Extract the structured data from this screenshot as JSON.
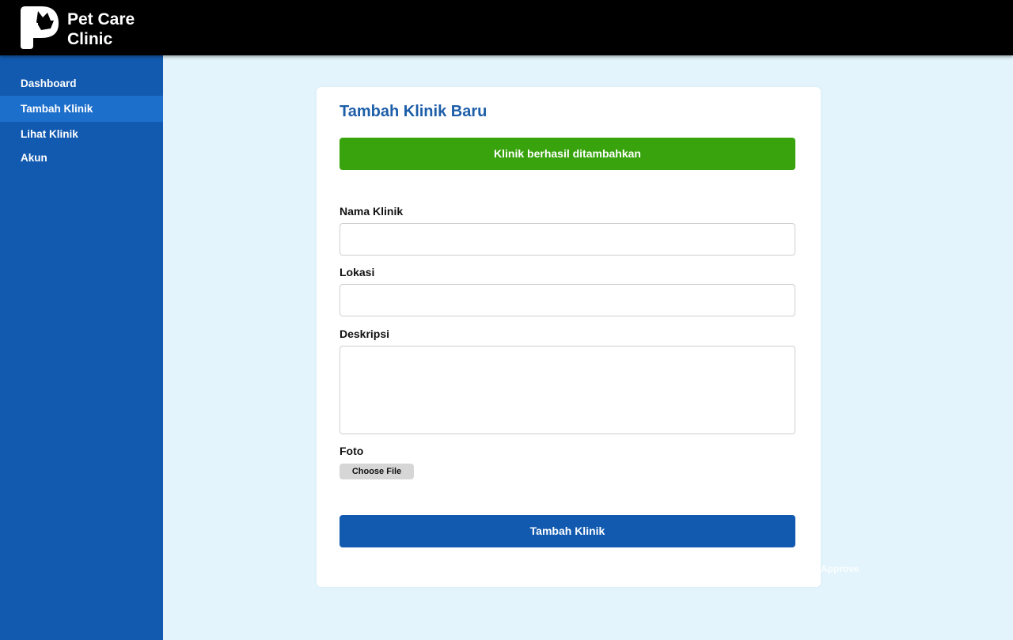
{
  "header": {
    "brand_line1": "Pet Care",
    "brand_line2": "Clinic",
    "logo_icon": "pet-clinic-logo-icon",
    "background": "#000000"
  },
  "sidebar": {
    "background": "#125ab0",
    "active_background": "#1d6fcc",
    "items": [
      {
        "label": "Dashboard",
        "active": false
      },
      {
        "label": "Tambah Klinik",
        "active": true
      },
      {
        "label": "Lihat Klinik",
        "active": false
      },
      {
        "label": "Akun",
        "active": false
      }
    ]
  },
  "form": {
    "title": "Tambah Klinik Baru",
    "success_message": "Klinik berhasil ditambahkan",
    "success_color": "#38a30d",
    "fields": {
      "name_label": "Nama Klinik",
      "name_value": "",
      "location_label": "Lokasi",
      "location_value": "",
      "description_label": "Deskripsi",
      "description_value": "",
      "photo_label": "Foto",
      "file_button": "Choose File"
    },
    "submit_label": "Tambah Klinik",
    "accent": "#125ab0"
  },
  "overlay_text": "Approve"
}
